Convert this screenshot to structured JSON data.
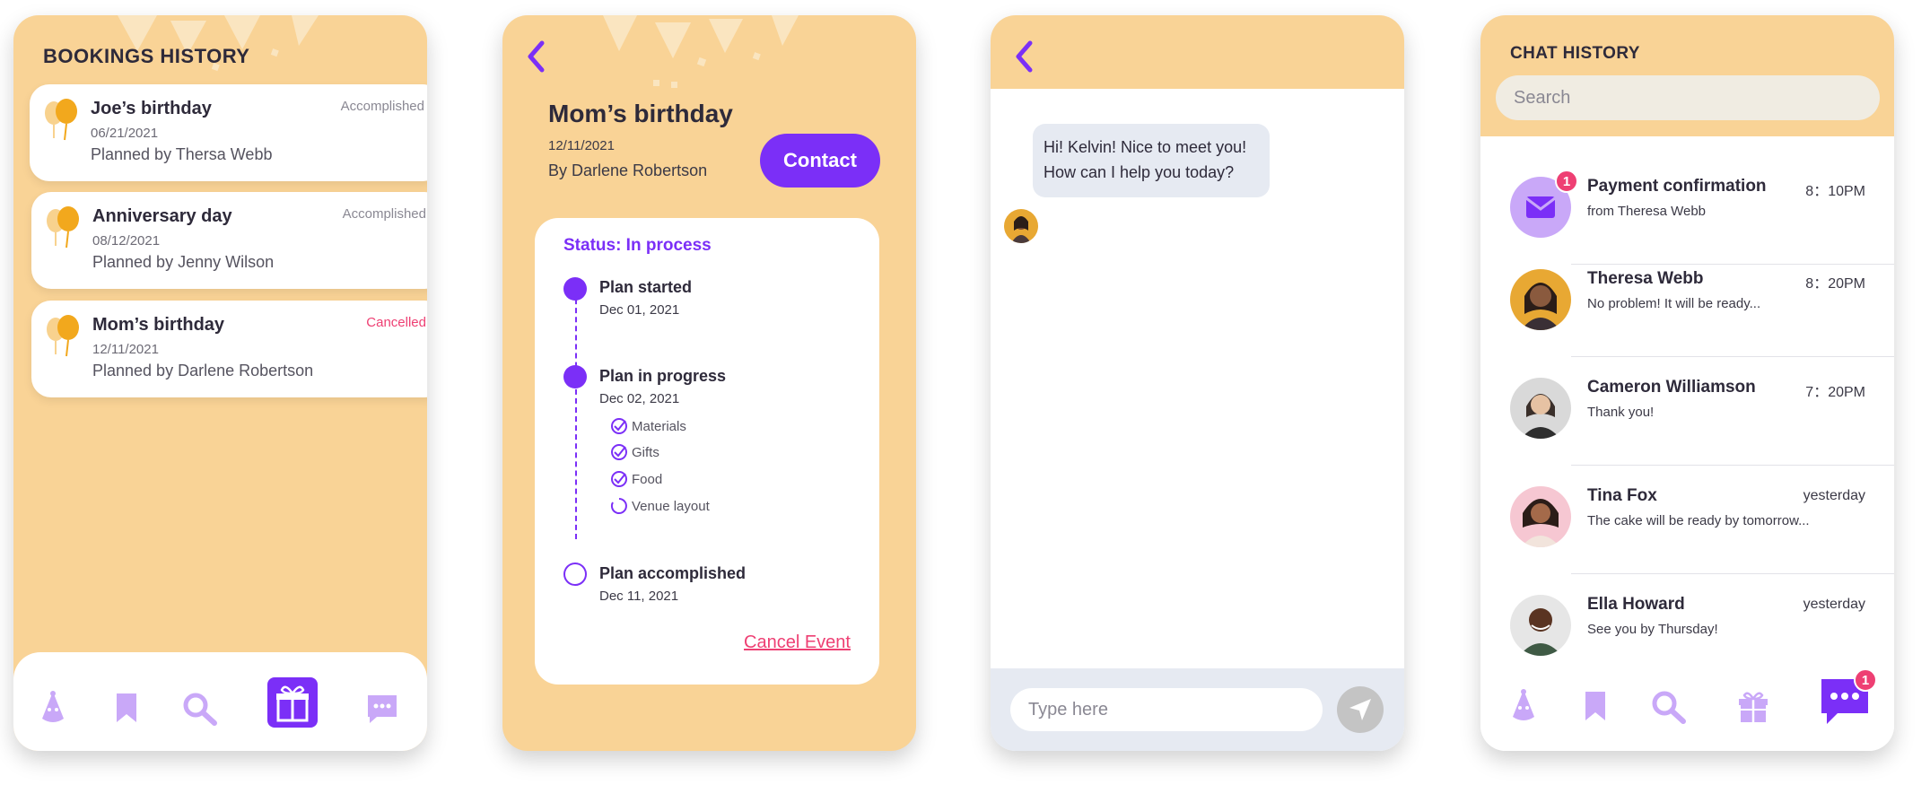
{
  "colors": {
    "accent": "#7b2ff7",
    "background": "#f9d396",
    "danger": "#ee3f73",
    "muted": "#b58cf5"
  },
  "bookings": {
    "title": "BOOKINGS HISTORY",
    "items": [
      {
        "name": "Joe’s birthday",
        "date": "06/21/2021",
        "planner": "Planned by Thersa Webb",
        "status": "Accomplished",
        "status_type": "done"
      },
      {
        "name": "Anniversary day",
        "date": "08/12/2021",
        "planner": "Planned by Jenny Wilson",
        "status": "Accomplished",
        "status_type": "done"
      },
      {
        "name": "Mom’s birthday",
        "date": "12/11/2021",
        "planner": "Planned by Darlene Robertson",
        "status": "Cancelled",
        "status_type": "cancelled"
      }
    ],
    "nav": [
      "party-hat-icon",
      "bookmark-icon",
      "search-icon",
      "gift-icon",
      "chat-icon"
    ]
  },
  "event": {
    "title": "Mom’s birthday",
    "date": "12/11/2021",
    "by": "By Darlene Robertson",
    "contact_label": "Contact",
    "status_label": "Status: In process",
    "timeline": [
      {
        "title": "Plan started",
        "date": "Dec 01, 2021"
      },
      {
        "title": "Plan in progress",
        "date": "Dec 02, 2021"
      },
      {
        "title": "Plan accomplished",
        "date": "Dec 11, 2021"
      }
    ],
    "tasks": [
      "Materials",
      "Gifts",
      "Food",
      "Venue layout"
    ],
    "cancel_label": "Cancel Event"
  },
  "chat": {
    "message_line1": "Hi! Kelvin! Nice to meet you!",
    "message_line2": "How can I help you today?",
    "input_placeholder": "Type here"
  },
  "chat_history": {
    "title": "CHAT HISTORY",
    "search_placeholder": "Search",
    "rows": [
      {
        "name": "Payment confirmation",
        "message": "from Theresa Webb",
        "time": "8：10PM",
        "badge": "1"
      },
      {
        "name": "Theresa Webb",
        "message": "No problem! It will be ready...",
        "time": "8：20PM"
      },
      {
        "name": "Cameron Williamson",
        "message": "Thank you!",
        "time": "7：20PM"
      },
      {
        "name": "Tina Fox",
        "message": "The cake will be ready by tomorrow...",
        "time": "yesterday"
      },
      {
        "name": "Ella Howard",
        "message": "See you by Thursday!",
        "time": "yesterday"
      }
    ],
    "nav_badge": "1"
  }
}
